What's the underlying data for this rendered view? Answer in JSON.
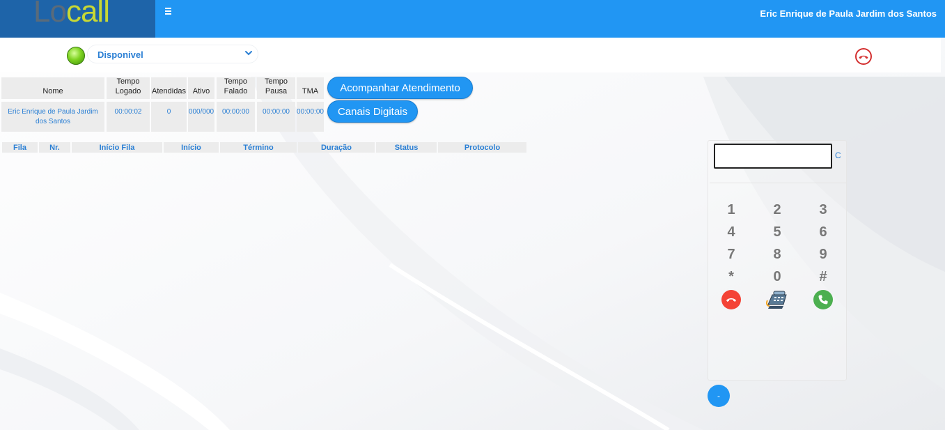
{
  "header": {
    "logo_part1": "Lo",
    "logo_part2": "call",
    "user_name": "Eric Enrique de Paula Jardim dos Santos",
    "menu_icon": "hamburger-icon"
  },
  "status": {
    "selected": "Disponivel",
    "indicator_color": "#7ed321"
  },
  "agent_table": {
    "headers": [
      "Nome",
      "Tempo Logado",
      "Atendidas",
      "Ativo",
      "Tempo Falado",
      "Tempo Pausa",
      "TMA"
    ],
    "row": [
      "Eric Enrique de Paula Jardim dos Santos",
      "00:00:02",
      "0",
      "000/000",
      "00:00:00",
      "00:00:00",
      "00:00:00"
    ]
  },
  "buttons": {
    "acompanhar": "Acompanhar Atendimento",
    "canais": "Canais Digitais"
  },
  "calls_table": {
    "headers": [
      "Fila",
      "Nr.",
      "Início Fila",
      "Início",
      "Término",
      "Duração",
      "Status",
      "Protocolo"
    ]
  },
  "dialer": {
    "input_value": "",
    "clear_label": "C",
    "keys": [
      "1",
      "2",
      "3",
      "4",
      "5",
      "6",
      "7",
      "8",
      "9",
      "*",
      "0",
      "#"
    ],
    "minimize_label": "-"
  },
  "colors": {
    "header": "#2196f3",
    "logo_bg": "#1e64a9",
    "accent_text": "#2a7fd4",
    "hangup": "#f44336",
    "call": "#4caf50"
  }
}
